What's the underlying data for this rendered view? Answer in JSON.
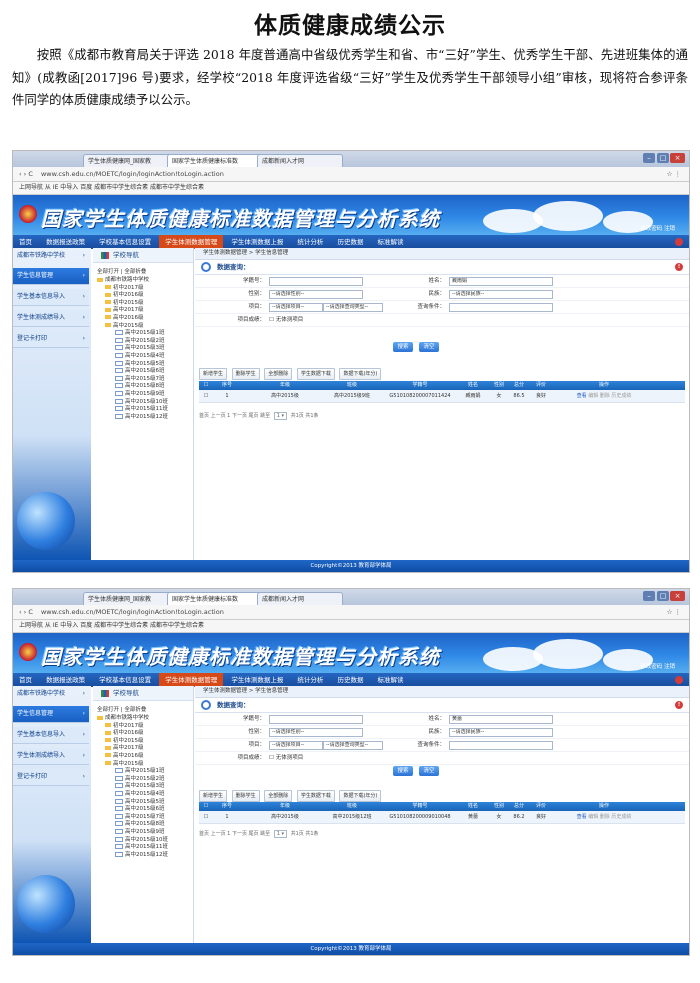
{
  "doc": {
    "title": "体质健康成绩公示",
    "paragraph": "按照《成都市教育局关于评选 2018 年度普通高中省级优秀学生和省、市“三好”学生、优秀学生干部、先进班集体的通知》(成教函[2017]96 号)要求，经学校“2018 年度评选省级“三好”学生及优秀学生干部领导小组”审核，现将符合参评条件同学的体质健康成绩予以公示。"
  },
  "colors": {
    "banner": "#2f88e6",
    "menu": "#184c9c",
    "active_menu": "#d64a1a",
    "table_head": "#1864b8",
    "link": "#1a55c7"
  },
  "browser": {
    "tabs": [
      "学生体质健康网_国家教",
      "国家学生体质健康标准数",
      "成都新闻入才网"
    ],
    "url": "www.csh.edu.cn/MOETC/login/loginAction!toLogin.action",
    "bookmarks": "上网导航   从 IE 中导入   百度   成都市中学生综合素   成都市中学生综合素"
  },
  "app": {
    "system_title": "国家学生体质健康标准数据管理与分析系统",
    "header_links": "修改密码   注销",
    "menu": [
      "首页",
      "数据报送政策",
      "学校基本信息设置",
      "学生体测数据管理",
      "学生体测数据上报",
      "统计分析",
      "历史数据",
      "标准解读"
    ],
    "active_menu_index": 3,
    "left_nav": [
      "成都市铁路中学校",
      "学生信息管理",
      "学生基本信息导入",
      "学生体测成绩导入",
      "登记卡打印"
    ],
    "left_nav_selected": 1,
    "tree_title": "学校导航",
    "tree_links": "全部打开 | 全部折叠",
    "tree_root": "成都市铁路中学校",
    "breadcrumb": "学生体测数据管理  >  学生信息管理",
    "query_title": "数据查询：",
    "query": {
      "labels": [
        "学籍号：",
        "性别：",
        "项目：",
        "项目成绩：",
        "姓名：",
        "民族：",
        "查询条件："
      ],
      "gender_placeholder": "--请选择性别--",
      "item_placeholder": "--请选择项目--",
      "type_placeholder": "--请选择查询类型--",
      "nation_placeholder": "--请选择民族--",
      "noexempt": "无体测项目"
    },
    "buttons": {
      "search": "搜索",
      "clear": "清空"
    },
    "tools": [
      "新增学生",
      "删除学生",
      "全部删除",
      "学生数据下载",
      "数据下载(年分)"
    ],
    "table_headers": [
      "",
      "序号",
      "年级",
      "班级",
      "学籍号",
      "姓名",
      "性别",
      "总分",
      "评价",
      "操作"
    ],
    "ops": [
      "查看",
      "编辑",
      "删除",
      "历史成绩"
    ],
    "pager_prefix": "首页  上一页  1  下一页  尾页  跳至",
    "pager_suffix": "共1页 共1条",
    "footer": "Copyright©2013 教育部学体局"
  },
  "screenshots": [
    {
      "tree": [
        "初中2017级",
        "初中2016级",
        "初中2015级",
        "高中2017级",
        "高中2016级",
        "高中2015级",
        "高中2015级1班",
        "高中2015级2班",
        "高中2015级3班",
        "高中2015级4班",
        "高中2015级5班",
        "高中2015级6班",
        "高中2015级7班",
        "高中2015级8班",
        "高中2015级9班",
        "高中2015级10班",
        "高中2015级11班",
        "高中2015级12班"
      ],
      "name_value": "臧雨娟",
      "row": [
        "1",
        "高中2015级",
        "高中2015级9班",
        "G510108200007011424",
        "臧雨娟",
        "女",
        "86.5",
        "良好"
      ]
    },
    {
      "tree": [
        "初中2017级",
        "初中2016级",
        "初中2015级",
        "高中2017级",
        "高中2016级",
        "高中2015级",
        "高中2015级1班",
        "高中2015级2班",
        "高中2015级3班",
        "高中2015级4班",
        "高中2015级5班",
        "高中2015级6班",
        "高中2015级7班",
        "高中2015级8班",
        "高中2015级9班",
        "高中2015级10班",
        "高中2015级11班",
        "高中2015级12班"
      ],
      "name_value": "黄蕾",
      "row": [
        "1",
        "高中2015级",
        "高中2015级12班",
        "G510108200009010048",
        "黄蕾",
        "女",
        "86.2",
        "良好"
      ]
    }
  ]
}
